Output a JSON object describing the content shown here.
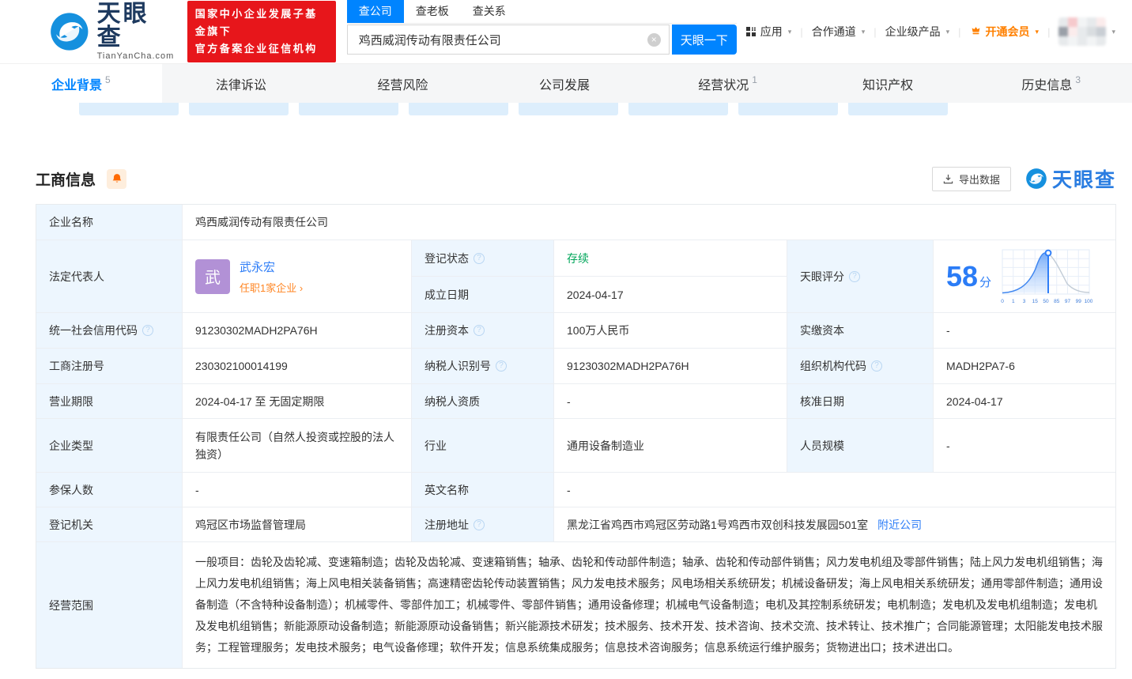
{
  "header": {
    "logo": {
      "title": "天眼查",
      "subtitle": "TianYanCha.com"
    },
    "badge": {
      "line1": "国家中小企业发展子基金旗下",
      "line2": "官方备案企业征信机构"
    },
    "search": {
      "tabs": [
        {
          "label": "查公司"
        },
        {
          "label": "查老板"
        },
        {
          "label": "查关系"
        }
      ],
      "value": "鸡西威润传动有限责任公司",
      "button": "天眼一下"
    },
    "nav": {
      "apps": "应用",
      "partner": "合作通道",
      "enterprise": "企业级产品",
      "vip": "开通会员"
    }
  },
  "tabs": {
    "items": [
      {
        "label": "企业背景",
        "count": "5"
      },
      {
        "label": "法律诉讼",
        "count": ""
      },
      {
        "label": "经营风险",
        "count": ""
      },
      {
        "label": "公司发展",
        "count": ""
      },
      {
        "label": "经营状况",
        "count": "1"
      },
      {
        "label": "知识产权",
        "count": ""
      },
      {
        "label": "历史信息",
        "count": "3"
      }
    ]
  },
  "section": {
    "title": "工商信息",
    "export_label": "导出数据",
    "brand": "天眼查"
  },
  "info": {
    "company_name_label": "企业名称",
    "company_name": "鸡西威润传动有限责任公司",
    "legal_rep_label": "法定代表人",
    "legal_rep_avatar": "武",
    "legal_rep_name": "武永宏",
    "legal_rep_link": "任职1家企业 ›",
    "reg_status_label": "登记状态",
    "reg_status": "存续",
    "establish_label": "成立日期",
    "establish_date": "2024-04-17",
    "score_label": "天眼评分",
    "score_value": "58",
    "score_unit": "分",
    "credit_code_label": "统一社会信用代码",
    "credit_code": "91230302MADH2PA76H",
    "reg_capital_label": "注册资本",
    "reg_capital": "100万人民币",
    "paid_capital_label": "实缴资本",
    "paid_capital": "-",
    "reg_number_label": "工商注册号",
    "reg_number": "230302100014199",
    "taxpayer_id_label": "纳税人识别号",
    "taxpayer_id": "91230302MADH2PA76H",
    "org_code_label": "组织机构代码",
    "org_code": "MADH2PA7-6",
    "business_term_label": "营业期限",
    "business_term": "2024-04-17 至 无固定期限",
    "taxpayer_quality_label": "纳税人资质",
    "taxpayer_quality": "-",
    "approval_date_label": "核准日期",
    "approval_date": "2024-04-17",
    "company_type_label": "企业类型",
    "company_type": "有限责任公司（自然人投资或控股的法人独资）",
    "industry_label": "行业",
    "industry": "通用设备制造业",
    "staff_size_label": "人员规模",
    "staff_size": "-",
    "insured_label": "参保人数",
    "insured": "-",
    "english_name_label": "英文名称",
    "english_name": "-",
    "reg_authority_label": "登记机关",
    "reg_authority": "鸡冠区市场监督管理局",
    "address_label": "注册地址",
    "address": "黑龙江省鸡西市鸡冠区劳动路1号鸡西市双创科技发展园501室",
    "nearby_link": "附近公司",
    "scope_label": "经营范围",
    "scope": "一般项目：齿轮及齿轮减、变速箱制造；齿轮及齿轮减、变速箱销售；轴承、齿轮和传动部件制造；轴承、齿轮和传动部件销售；风力发电机组及零部件销售；陆上风力发电机组销售；海上风力发电机组销售；海上风电相关装备销售；高速精密齿轮传动装置销售；风力发电技术服务；风电场相关系统研发；机械设备研发；海上风电相关系统研发；通用零部件制造；通用设备制造（不含特种设备制造）；机械零件、零部件加工；机械零件、零部件销售；通用设备修理；机械电气设备制造；电机及其控制系统研发；电机制造；发电机及发电机组制造；发电机及发电机组销售；新能源原动设备制造；新能源原动设备销售；新兴能源技术研发；技术服务、技术开发、技术咨询、技术交流、技术转让、技术推广；合同能源管理；太阳能发电技术服务；工程管理服务；发电技术服务；电气设备修理；软件开发；信息系统集成服务；信息技术咨询服务；信息系统运行维护服务；货物进出口；技术进出口。"
  },
  "chart_data": {
    "type": "area",
    "title": "天眼评分分布曲线",
    "x_tick_labels": [
      "0",
      "1",
      "3",
      "15",
      "50",
      "85",
      "97",
      "99",
      "100"
    ],
    "marker_score": 58,
    "legend_position": "none",
    "grid": true
  },
  "icons": {
    "help": "?",
    "clear": "×",
    "caret": "▾",
    "separator": "|"
  },
  "colors": {
    "accent": "#0084ff",
    "score_blue": "#2b7cf6",
    "green": "#00a65a",
    "orange_link": "#ff8624",
    "vip_orange": "#ff8000",
    "badge_red": "#e7161b",
    "label_bg": "#edf6fe",
    "avatar_purple": "#b291d6"
  }
}
